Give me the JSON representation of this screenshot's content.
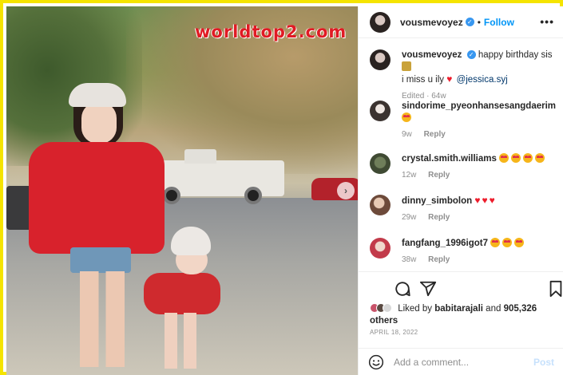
{
  "photo": {
    "watermark": "worldtop2.com"
  },
  "header": {
    "username": "vousmevoyez",
    "follow_label": "Follow",
    "separator": "•"
  },
  "caption": {
    "username": "vousmevoyez",
    "text": "happy birthday sis",
    "text2": "i miss u ily",
    "mention": "@jessica.syj",
    "meta": "Edited · 64w"
  },
  "comments": [
    {
      "username": "sindorime_pyeonhansesangdaerim",
      "text": "",
      "age": "9w",
      "reply": "Reply",
      "emojis": 1
    },
    {
      "username": "crystal.smith.williams",
      "text": "",
      "age": "12w",
      "reply": "Reply",
      "emojis": 4
    },
    {
      "username": "dinny_simbolon",
      "text": "",
      "age": "29w",
      "reply": "Reply",
      "hearts": 3
    },
    {
      "username": "fangfang_1996igot7",
      "text": "",
      "age": "38w",
      "reply": "Reply",
      "emojis": 3
    }
  ],
  "likes": {
    "prefix": "Liked by",
    "user": "babitarajali",
    "and": "and",
    "count": "905,326",
    "suffix": "others"
  },
  "date": "April 18, 2022",
  "add_comment": {
    "placeholder": "Add a comment...",
    "post_label": "Post"
  },
  "icons": {
    "more": "more-options-icon",
    "verified": "verified-badge-icon",
    "comment": "comment-icon",
    "share": "share-icon",
    "save": "bookmark-icon",
    "emoji": "emoji-icon",
    "next": "chevron-right-icon"
  },
  "colors": {
    "accent": "#0095f6",
    "verified": "#3897f0",
    "frame": "#f5e400",
    "heart": "#ed1c2b"
  }
}
